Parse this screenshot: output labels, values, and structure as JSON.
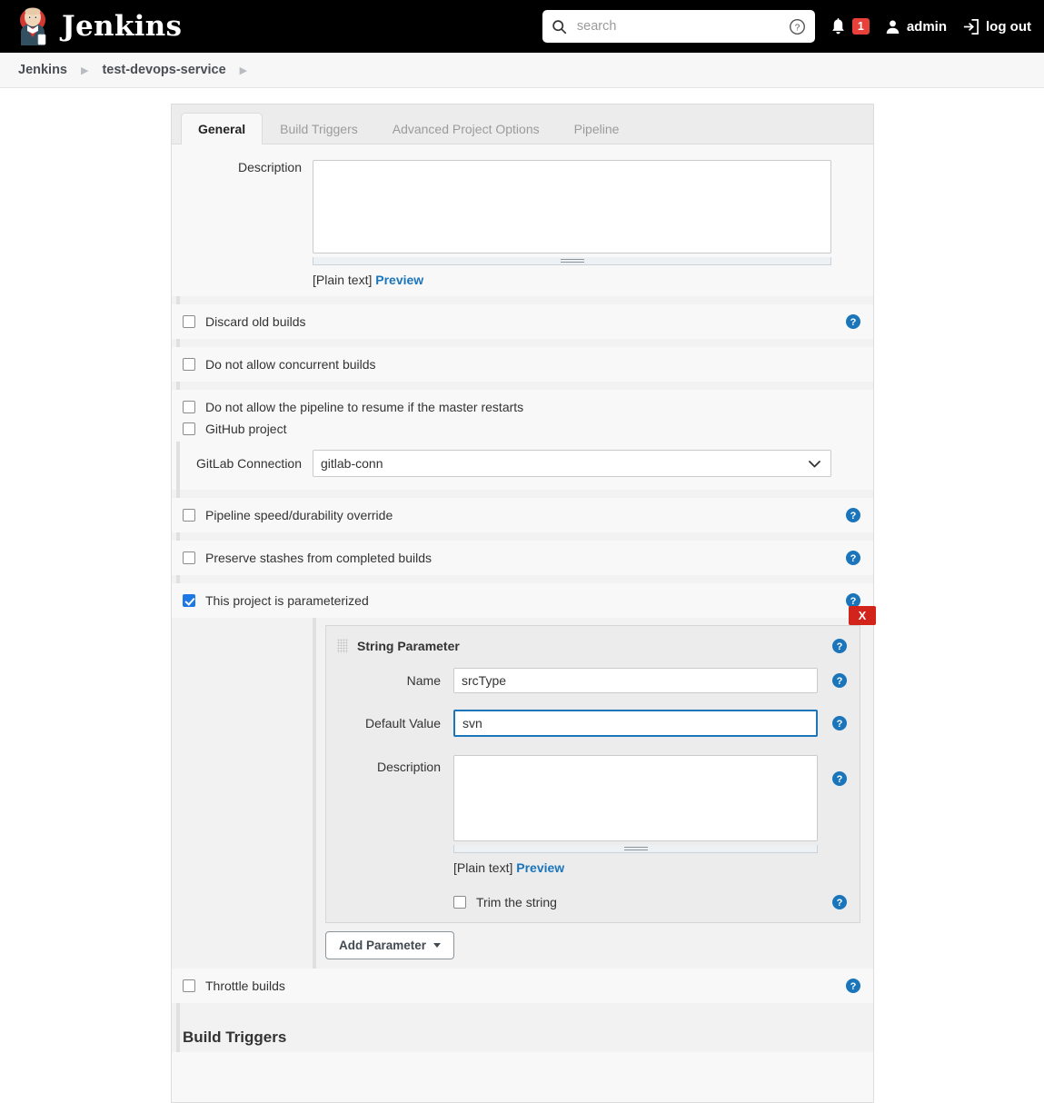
{
  "header": {
    "brand": "Jenkins",
    "logo_icon": "jenkins-butler-logo",
    "search": {
      "placeholder": "search",
      "value": "",
      "icon": "search-icon",
      "help_icon": "help-circle-icon"
    },
    "notifications": {
      "icon": "bell-icon",
      "count": "1"
    },
    "user": {
      "icon": "person-icon",
      "name": "admin"
    },
    "logout": {
      "icon": "logout-icon",
      "label": "log out"
    }
  },
  "breadcrumb": {
    "items": [
      {
        "label": "Jenkins"
      },
      {
        "label": "test-devops-service"
      }
    ],
    "separator_icon": "chevron-right-icon"
  },
  "tabs": [
    {
      "label": "General",
      "active": true
    },
    {
      "label": "Build Triggers",
      "active": false
    },
    {
      "label": "Advanced Project Options",
      "active": false
    },
    {
      "label": "Pipeline",
      "active": false
    }
  ],
  "general": {
    "description": {
      "label": "Description",
      "value": "",
      "plain_text_note": "[Plain text]",
      "preview_link": "Preview"
    },
    "options": [
      {
        "label": "Discard old builds",
        "checked": false,
        "help": true
      },
      {
        "label": "Do not allow concurrent builds",
        "checked": false,
        "help": false
      },
      {
        "label": "Do not allow the pipeline to resume if the master restarts",
        "checked": false,
        "help": false
      },
      {
        "label": "GitHub project",
        "checked": false,
        "help": false
      },
      {
        "label": "Pipeline speed/durability override",
        "checked": false,
        "help": true
      },
      {
        "label": "Preserve stashes from completed builds",
        "checked": false,
        "help": true
      },
      {
        "label": "This project is parameterized",
        "checked": true,
        "help": true
      },
      {
        "label": "Throttle builds",
        "checked": false,
        "help": true
      }
    ],
    "gitlab_connection": {
      "label": "GitLab Connection",
      "selected": "gitlab-conn",
      "options": [
        "gitlab-conn"
      ]
    }
  },
  "parameter": {
    "title": "String Parameter",
    "delete_label": "X",
    "grip_icon": "drag-handle-icon",
    "name": {
      "label": "Name",
      "value": "srcType"
    },
    "default_value": {
      "label": "Default Value",
      "value": "svn"
    },
    "description": {
      "label": "Description",
      "value": "",
      "plain_text_note": "[Plain text]",
      "preview_link": "Preview"
    },
    "trim": {
      "label": "Trim the string",
      "checked": false
    },
    "add_button": "Add Parameter"
  },
  "bottom_section_heading": "Build Triggers",
  "colors": {
    "accent_blue": "#1b75bb",
    "checkbox_blue": "#1d78e3",
    "delete_red": "#d3241c",
    "badge_red": "#e8403a",
    "header_black": "#000000"
  }
}
